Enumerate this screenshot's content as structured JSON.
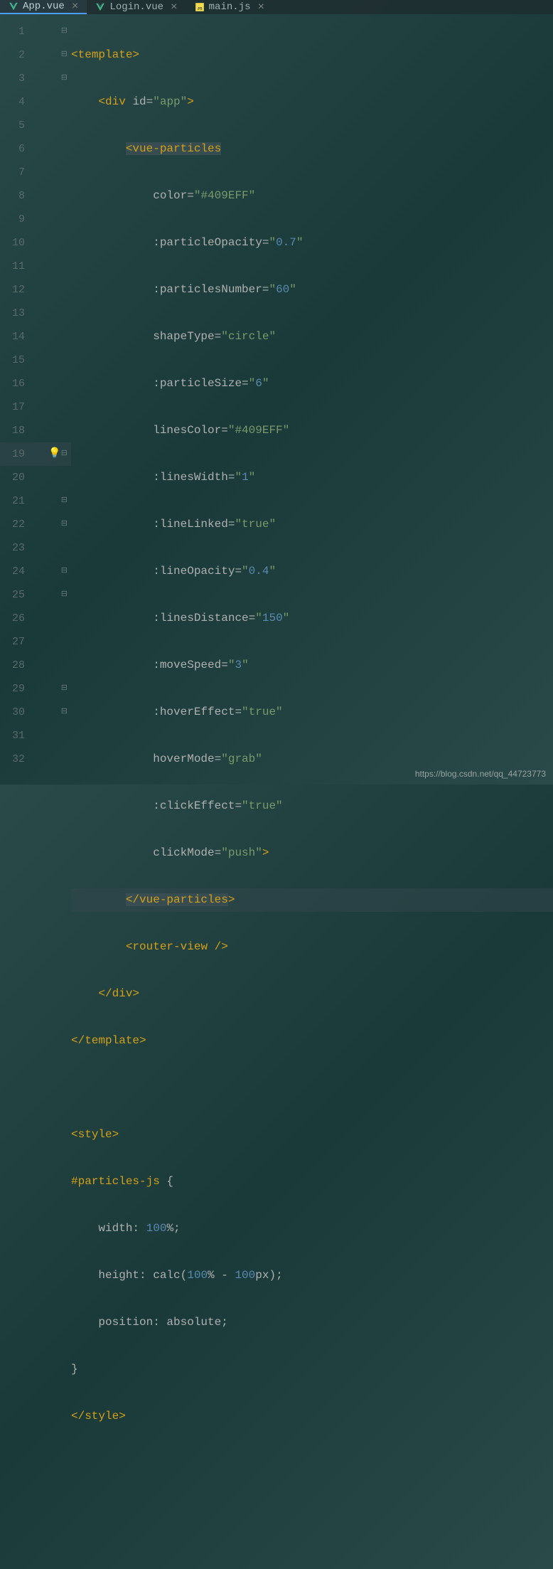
{
  "tabs": [
    {
      "name": "App.vue",
      "type": "vue",
      "active": true,
      "closeable": true
    },
    {
      "name": "Login.vue",
      "type": "vue",
      "active": false,
      "closeable": true
    },
    {
      "name": "main.js",
      "type": "js",
      "active": false,
      "closeable": true
    }
  ],
  "lineNumbers": [
    "1",
    "2",
    "3",
    "4",
    "5",
    "6",
    "7",
    "8",
    "9",
    "10",
    "11",
    "12",
    "13",
    "14",
    "15",
    "16",
    "17",
    "18",
    "19",
    "20",
    "21",
    "22",
    "23",
    "24",
    "25",
    "26",
    "27",
    "28",
    "29",
    "30",
    "31",
    "32"
  ],
  "code": {
    "l1": {
      "open": "<",
      "tag": "template",
      "close": ">"
    },
    "l2": {
      "open": "<",
      "tag": "div",
      "attr": "id",
      "val": "\"app\"",
      "close": ">"
    },
    "l3": {
      "open": "<",
      "tag": "vue-particles"
    },
    "l4": {
      "attr": "color",
      "val": "\"#409EFF\""
    },
    "l5": {
      "attr": ":particleOpacity",
      "val": "\"",
      "num": "0.7",
      "valEnd": "\""
    },
    "l6": {
      "attr": ":particlesNumber",
      "val": "\"",
      "num": "60",
      "valEnd": "\""
    },
    "l7": {
      "attr": "shapeType",
      "val": "\"circle\""
    },
    "l8": {
      "attr": ":particleSize",
      "val": "\"",
      "num": "6",
      "valEnd": "\""
    },
    "l9": {
      "attr": "linesColor",
      "val": "\"#409EFF\""
    },
    "l10": {
      "attr": ":linesWidth",
      "val": "\"",
      "num": "1",
      "valEnd": "\""
    },
    "l11": {
      "attr": ":lineLinked",
      "val": "\"true\""
    },
    "l12": {
      "attr": ":lineOpacity",
      "val": "\"",
      "num": "0.4",
      "valEnd": "\""
    },
    "l13": {
      "attr": ":linesDistance",
      "val": "\"",
      "num": "150",
      "valEnd": "\""
    },
    "l14": {
      "attr": ":moveSpeed",
      "val": "\"",
      "num": "3",
      "valEnd": "\""
    },
    "l15": {
      "attr": ":hoverEffect",
      "val": "\"true\""
    },
    "l16": {
      "attr": "hoverMode",
      "val": "\"grab\""
    },
    "l17": {
      "attr": ":clickEffect",
      "val": "\"true\""
    },
    "l18": {
      "attr": "clickMode",
      "val": "\"push\"",
      "close": ">"
    },
    "l19": {
      "open": "</",
      "tag": "vue-particles",
      "close": ">"
    },
    "l20": {
      "open": "<",
      "tag": "router-view",
      "close": " />"
    },
    "l21": {
      "open": "</",
      "tag": "div",
      "close": ">"
    },
    "l22": {
      "open": "</",
      "tag": "template",
      "close": ">"
    },
    "l24": {
      "open": "<",
      "tag": "style",
      "close": ">"
    },
    "l25": {
      "selector": "#particles-js",
      "brace": " {"
    },
    "l26": {
      "prop": "width",
      "colon": ": ",
      "num": "100",
      "unit": "%;"
    },
    "l27": {
      "prop": "height",
      "colon": ": ",
      "func": "calc",
      "paren1": "(",
      "num1": "100",
      "unit1": "% - ",
      "num2": "100",
      "unit2": "px",
      "paren2": ");"
    },
    "l28": {
      "prop": "position",
      "colon": ": ",
      "val": "absolute",
      "semi": ";"
    },
    "l29": {
      "brace": "}"
    },
    "l30": {
      "open": "</",
      "tag": "style",
      "close": ">"
    }
  },
  "watermark": "https://blog.csdn.net/qq_44723773"
}
